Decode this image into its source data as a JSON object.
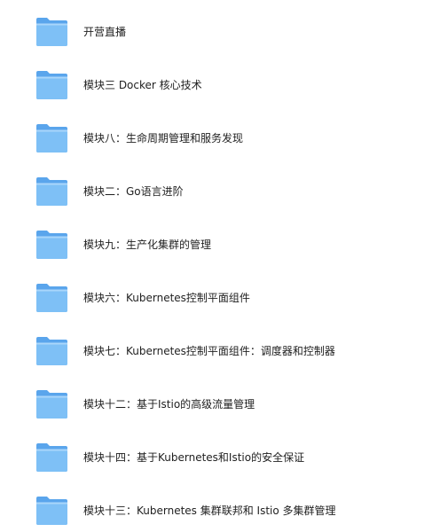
{
  "folders": [
    {
      "label": "开营直播",
      "icon": "folder-icon"
    },
    {
      "label": "模块三 Docker 核心技术",
      "icon": "folder-icon"
    },
    {
      "label": "模块八：生命周期管理和服务发现",
      "icon": "folder-icon"
    },
    {
      "label": "模块二：Go语言进阶",
      "icon": "folder-icon"
    },
    {
      "label": "模块九：生产化集群的管理",
      "icon": "folder-icon"
    },
    {
      "label": "模块六：Kubernetes控制平面组件",
      "icon": "folder-icon"
    },
    {
      "label": "模块七：Kubernetes控制平面组件：调度器和控制器",
      "icon": "folder-icon"
    },
    {
      "label": "模块十二：基于Istio的高级流量管理",
      "icon": "folder-icon"
    },
    {
      "label": "模块十四：基于Kubernetes和Istio的安全保证",
      "icon": "folder-icon"
    },
    {
      "label": "模块十三：Kubernetes 集群联邦和 Istio 多集群管理",
      "icon": "folder-icon"
    }
  ],
  "colors": {
    "folder_back": "#5aa5ec",
    "folder_front": "#7ec0f6",
    "folder_highlight": "#a9d6fb",
    "text": "#1f1f1f"
  }
}
